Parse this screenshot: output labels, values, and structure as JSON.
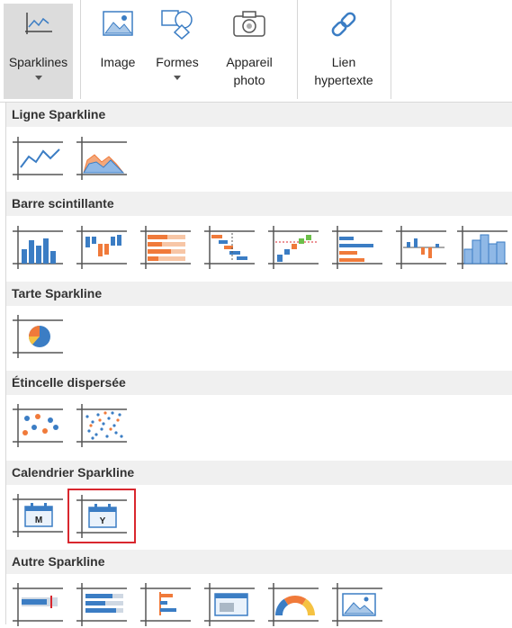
{
  "ribbon": {
    "sparklines": "Sparklines",
    "image": "Image",
    "formes": "Formes",
    "appareil_1": "Appareil",
    "appareil_2": "photo",
    "lien_1": "Lien",
    "lien_2": "hypertexte"
  },
  "sections": {
    "ligne": "Ligne Sparkline",
    "barre": "Barre scintillante",
    "tarte": "Tarte Sparkline",
    "etincelle": "Étincelle dispersée",
    "calendrier": "Calendrier Sparkline",
    "autre": "Autre Sparkline"
  },
  "calendar_letters": {
    "month": "M",
    "year": "Y"
  },
  "colors": {
    "blue": "#3b7dc4",
    "orange": "#f07a3a",
    "selection": "#d9272e",
    "header_bg": "#f0f0f0"
  }
}
